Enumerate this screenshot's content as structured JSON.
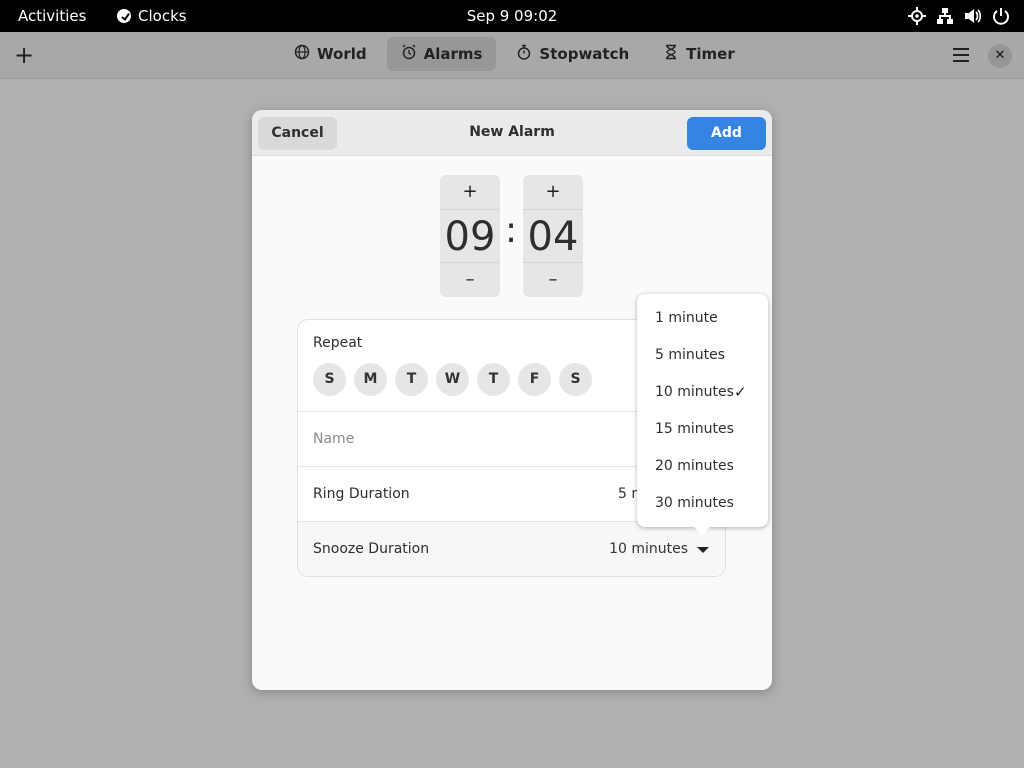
{
  "topbar": {
    "activities": "Activities",
    "app_name": "Clocks",
    "datetime": "Sep 9  09:02",
    "icons": [
      "location-icon",
      "network-icon",
      "volume-icon",
      "power-icon"
    ]
  },
  "headerbar": {
    "tabs": [
      {
        "label": "World",
        "icon": "globe-icon"
      },
      {
        "label": "Alarms",
        "icon": "alarm-icon",
        "active": true
      },
      {
        "label": "Stopwatch",
        "icon": "stopwatch-icon"
      },
      {
        "label": "Timer",
        "icon": "hourglass-icon"
      }
    ]
  },
  "dialog": {
    "cancel_label": "Cancel",
    "title": "New Alarm",
    "add_label": "Add",
    "hours": "09",
    "minutes": "04",
    "repeat_label": "Repeat",
    "days": [
      "S",
      "M",
      "T",
      "W",
      "T",
      "F",
      "S"
    ],
    "name_placeholder": "Name",
    "ring_duration_label": "Ring Duration",
    "ring_duration_value": "5 minutes",
    "snooze_duration_label": "Snooze Duration",
    "snooze_duration_value": "10 minutes"
  },
  "snooze_popover": {
    "options": [
      "1 minute",
      "5 minutes",
      "10 minutes",
      "15 minutes",
      "20 minutes",
      "30 minutes"
    ],
    "selected": "10 minutes"
  },
  "colors": {
    "accent": "#3584e4",
    "topbar": "#000000",
    "backdrop": "#b0b0b0"
  }
}
